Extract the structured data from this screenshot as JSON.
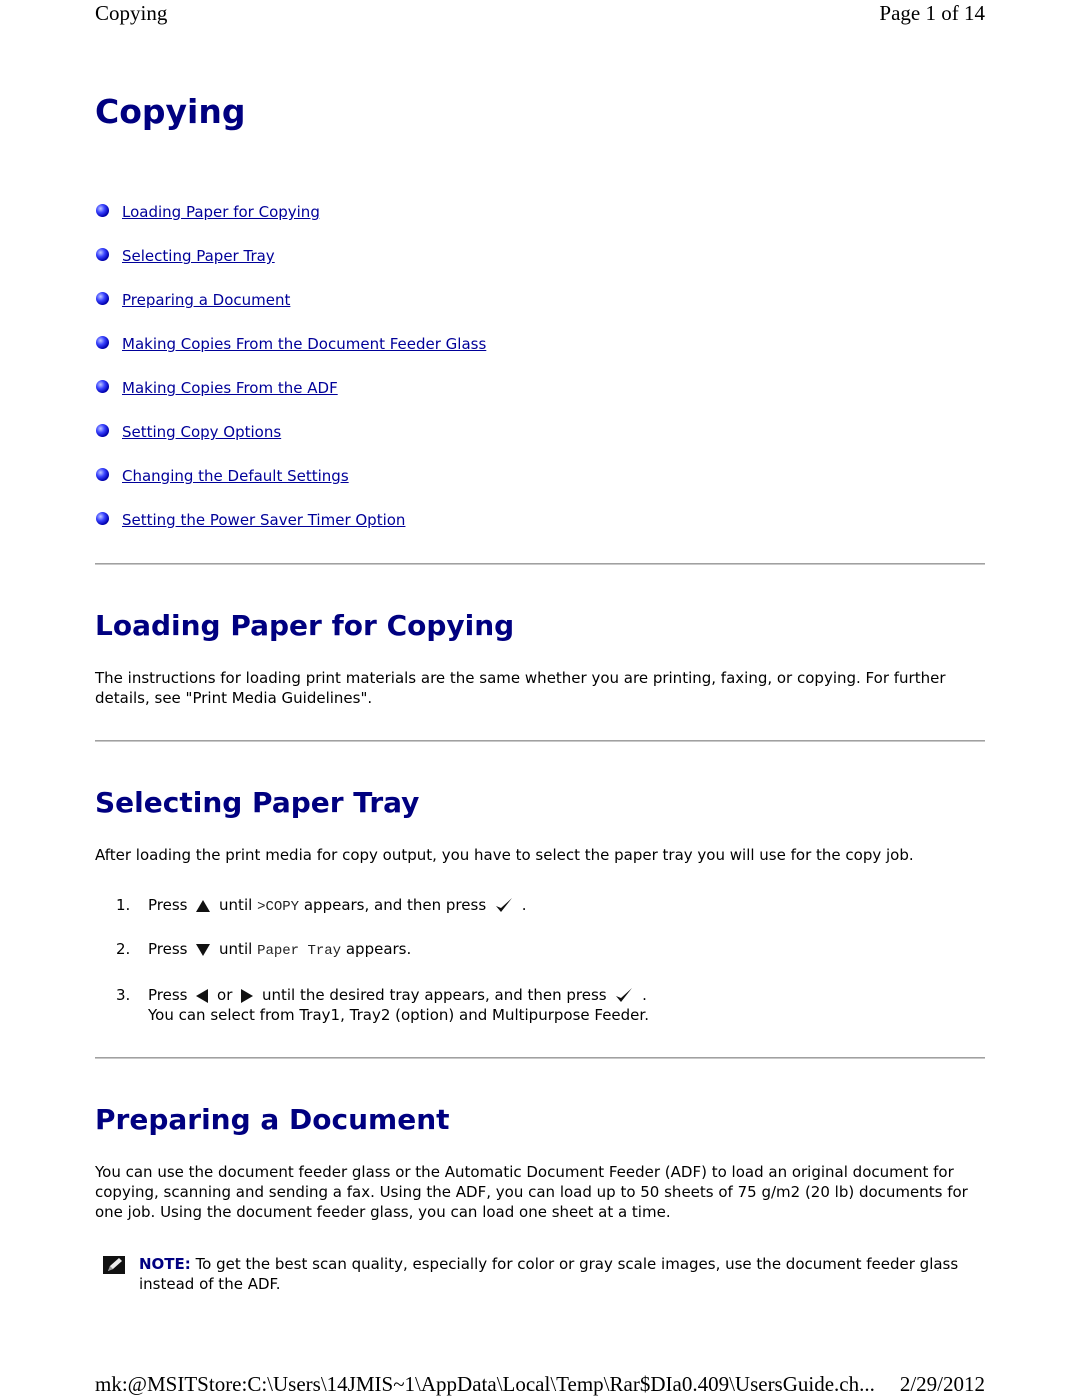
{
  "header": {
    "title": "Copying",
    "page_indicator": "Page 1 of 14"
  },
  "page_title": "Copying",
  "toc": [
    {
      "label": "Loading Paper for Copying"
    },
    {
      "label": "Selecting Paper Tray"
    },
    {
      "label": "Preparing a Document"
    },
    {
      "label": "Making Copies From the Document Feeder Glass"
    },
    {
      "label": "Making Copies From the ADF"
    },
    {
      "label": "Setting Copy Options"
    },
    {
      "label": "Changing the Default Settings"
    },
    {
      "label": "Setting the Power Saver Timer Option"
    }
  ],
  "sections": {
    "loading": {
      "title": "Loading Paper for Copying",
      "body": "The instructions for loading print materials are the same whether you are printing, faxing, or copying. For further details, see \"Print Media Guidelines\"."
    },
    "selecting": {
      "title": "Selecting Paper Tray",
      "intro": "After loading the print media for copy output, you have to select the paper tray you will use for the copy job.",
      "steps": [
        {
          "num": "1.",
          "press": "Press",
          "until": "until",
          "code": ">COPY",
          "after": "appears, and then press",
          "end": "."
        },
        {
          "num": "2.",
          "press": "Press",
          "until": "until",
          "code": "Paper Tray",
          "after": "appears."
        },
        {
          "num": "3.",
          "press": "Press",
          "or": "or",
          "after": "until the desired tray appears, and then press",
          "end": ".",
          "extra": "You can select from Tray1, Tray2 (option) and Multipurpose Feeder."
        }
      ],
      "icons": [
        "up-arrow-icon",
        "checkmark-icon",
        "down-arrow-icon",
        "left-arrow-icon",
        "right-arrow-icon"
      ]
    },
    "preparing": {
      "title": "Preparing a Document",
      "body": "You can use the document feeder glass or the Automatic Document Feeder (ADF) to load an original document for copying, scanning and sending a fax. Using the ADF, you can load up to 50 sheets of 75 g/m2 (20 lb) documents for one job. Using the document feeder glass, you can load one sheet at a time.",
      "note_label": "NOTE:",
      "note_text": " To get the best scan quality, especially for color or gray scale images, use the document feeder glass instead of the ADF."
    }
  },
  "footer": {
    "path": "mk:@MSITStore:C:\\Users\\14JMIS~1\\AppData\\Local\\Temp\\Rar$DIa0.409\\UsersGuide.ch...",
    "date": "2/29/2012"
  },
  "colors": {
    "heading": "#000080",
    "link": "#000099",
    "rule": "#a0a0a0"
  }
}
